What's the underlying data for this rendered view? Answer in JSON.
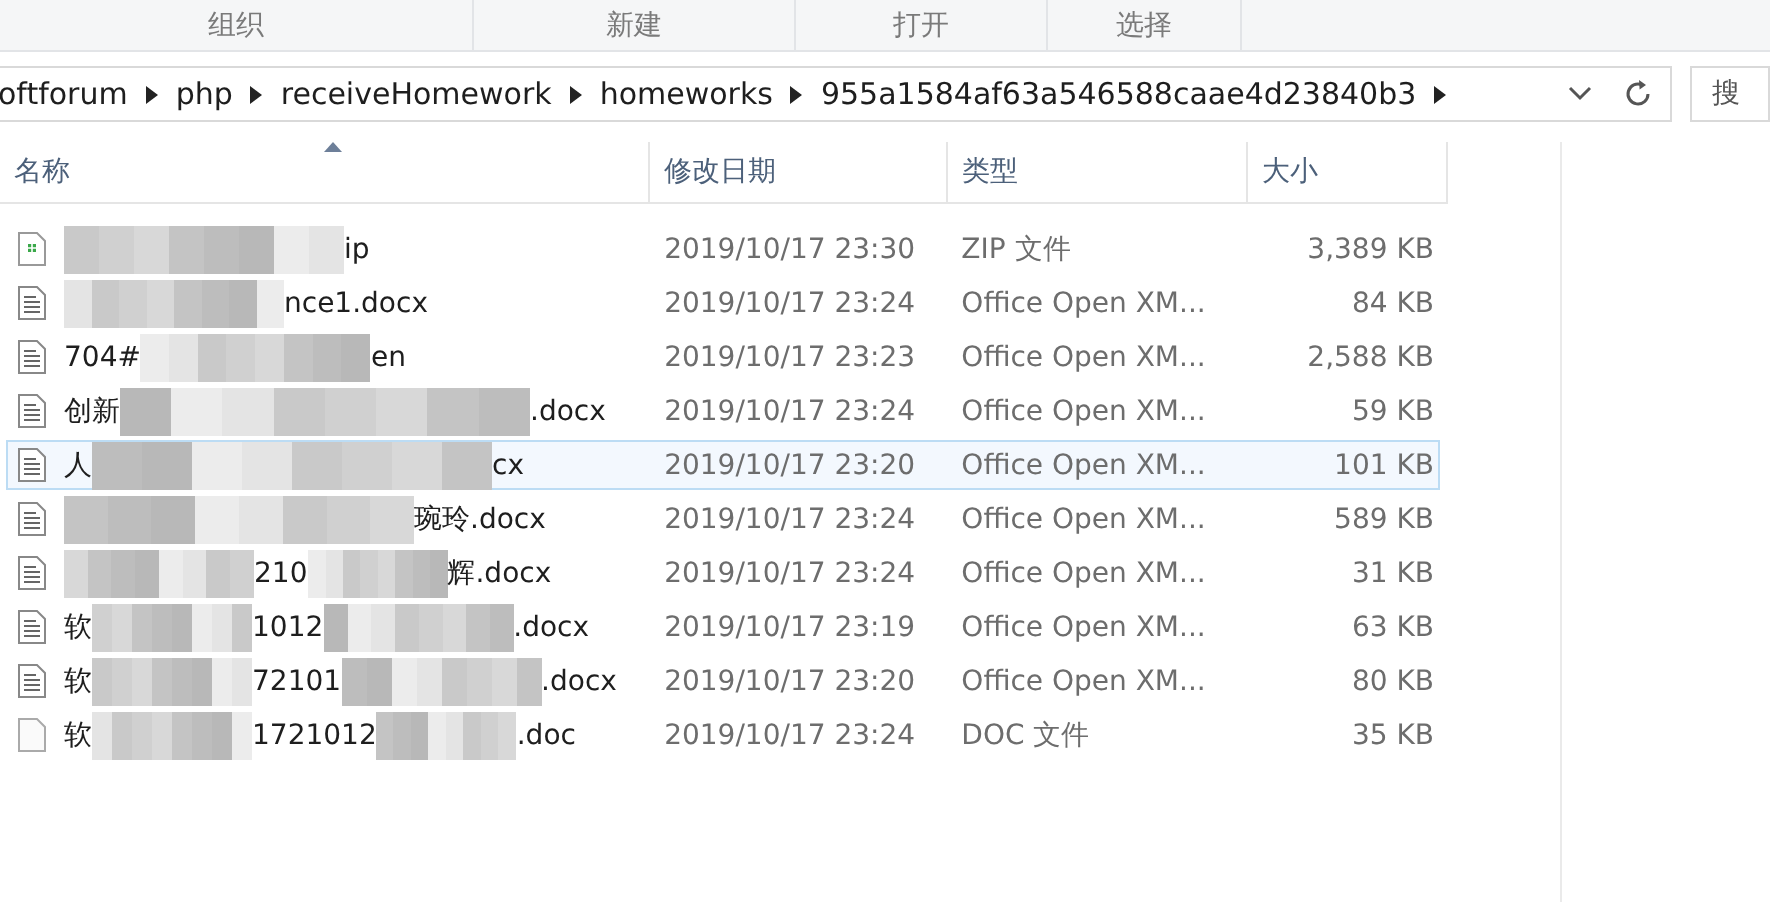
{
  "ribbon_tabs": [
    "组织",
    "新建",
    "打开",
    "选择"
  ],
  "address_bar": {
    "segments": [
      "oftforum",
      "php",
      "receiveHomework",
      "homeworks",
      "955a1584af63a546588caae4d23840b3"
    ]
  },
  "search": {
    "placeholder": "搜"
  },
  "columns": [
    {
      "label": "名称",
      "sorted": true
    },
    {
      "label": "修改日期",
      "sorted": false
    },
    {
      "label": "类型",
      "sorted": false
    },
    {
      "label": "大小",
      "sorted": false
    }
  ],
  "files": [
    {
      "kind": "zip",
      "name_end": "ip",
      "modified": "2019/10/17 23:30",
      "type": "ZIP 文件",
      "size": "3,389 KB",
      "hovered": false
    },
    {
      "kind": "docx",
      "name_end": "nce1.docx",
      "modified": "2019/10/17 23:24",
      "type": "Office Open XM...",
      "size": "84 KB",
      "hovered": false
    },
    {
      "kind": "docx",
      "name_start": "704#",
      "name_end": "en",
      "modified": "2019/10/17 23:23",
      "type": "Office Open XM...",
      "size": "2,588 KB",
      "hovered": false
    },
    {
      "kind": "docx",
      "name_start": "创新",
      "name_end": ".docx",
      "modified": "2019/10/17 23:24",
      "type": "Office Open XM...",
      "size": "59 KB",
      "hovered": false
    },
    {
      "kind": "docx",
      "name_start": "人",
      "name_end": "cx",
      "modified": "2019/10/17 23:20",
      "type": "Office Open XM...",
      "size": "101 KB",
      "hovered": true
    },
    {
      "kind": "docx",
      "name_end": "琬玲.docx",
      "modified": "2019/10/17 23:24",
      "type": "Office Open XM...",
      "size": "589 KB",
      "hovered": false
    },
    {
      "kind": "docx",
      "name_middle": "210",
      "name_end": "辉.docx",
      "modified": "2019/10/17 23:24",
      "type": "Office Open XM...",
      "size": "31 KB",
      "hovered": false
    },
    {
      "kind": "docx",
      "name_start": "软",
      "name_middle": "1012",
      "name_end": ".docx",
      "modified": "2019/10/17 23:19",
      "type": "Office Open XM...",
      "size": "63 KB",
      "hovered": false
    },
    {
      "kind": "docx",
      "name_start": "软",
      "name_middle": "72101",
      "name_end": ".docx",
      "modified": "2019/10/17 23:20",
      "type": "Office Open XM...",
      "size": "80 KB",
      "hovered": false
    },
    {
      "kind": "doc",
      "name_start": "软",
      "name_middle": "1721012",
      "name_end": ".doc",
      "modified": "2019/10/17 23:24",
      "type": "DOC 文件",
      "size": "35 KB",
      "hovered": false
    }
  ]
}
